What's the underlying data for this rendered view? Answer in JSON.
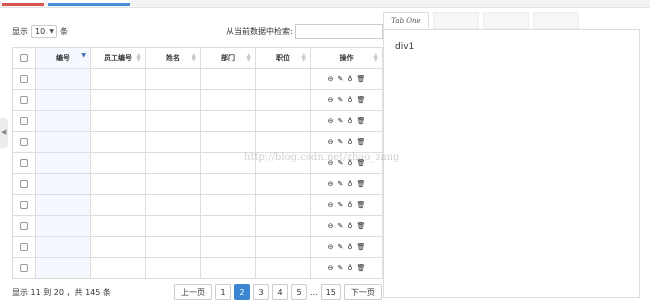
{
  "length": {
    "prefix": "显示",
    "value": "10",
    "suffix": "条"
  },
  "search": {
    "label": "从当前数据中检索:"
  },
  "table": {
    "columns": [
      "编号",
      "员工编号",
      "姓名",
      "部门",
      "职位",
      "操作"
    ],
    "row_count": 10
  },
  "footer": {
    "info": "显示 11 到 20 ，共 145 条"
  },
  "pagination": {
    "prev": "上一页",
    "pages": [
      "1",
      "2",
      "3",
      "4",
      "5"
    ],
    "ellipsis": "...",
    "last": "15",
    "next": "下一页",
    "current": "2"
  },
  "right_tabs": {
    "tab1": "Tab One",
    "tab2": "",
    "tab3": "",
    "tab4": "",
    "content": "div1"
  },
  "watermark": "http://blog.csdn.net/zhao_zang",
  "icons": {
    "view": "⊖",
    "edit": "✎",
    "key": "♁",
    "delete": "🗑"
  },
  "colors": {
    "active_page": "#3a86d1",
    "tab_red": "#d9534f",
    "tab_blue": "#4a8fd6"
  }
}
